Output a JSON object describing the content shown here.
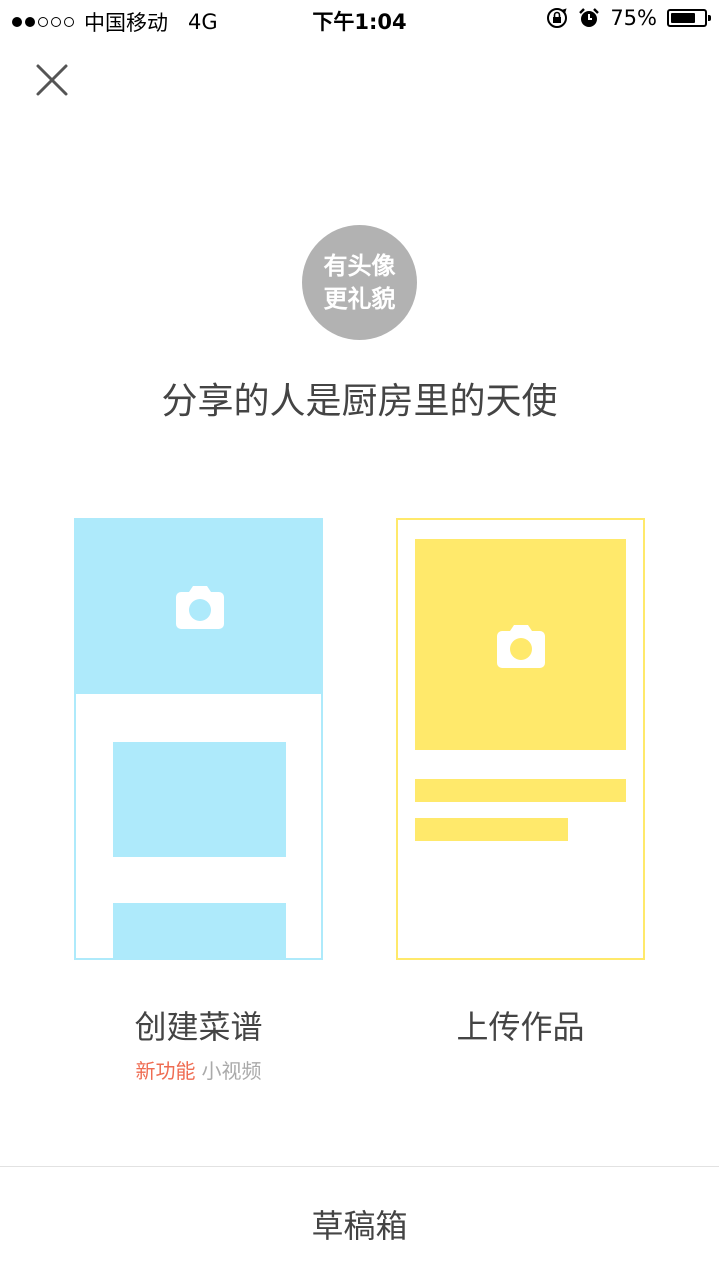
{
  "status_bar": {
    "signal_dots": [
      true,
      true,
      false,
      false,
      false
    ],
    "carrier": "中国移动",
    "network": "4G",
    "time": "下午1:04",
    "icons": [
      "rotation-lock-icon",
      "alarm-icon"
    ],
    "battery_percent": "75%",
    "battery_level": 0.75
  },
  "header": {
    "close_icon": "close-icon"
  },
  "avatar": {
    "line1": "有头像",
    "line2": "更礼貌"
  },
  "headline": "分享的人是厨房里的天使",
  "options": {
    "create_recipe": {
      "label": "创建菜谱",
      "new_tag": "新功能",
      "sub_text": "小视频",
      "color": "#aeeafb",
      "icon": "camera-icon"
    },
    "upload_work": {
      "label": "上传作品",
      "color": "#ffe96b",
      "icon": "camera-icon"
    }
  },
  "footer": {
    "drafts": "草稿箱"
  },
  "colors": {
    "new_tag": "#ef6c52",
    "avatar_bg": "#b2b2b2"
  }
}
